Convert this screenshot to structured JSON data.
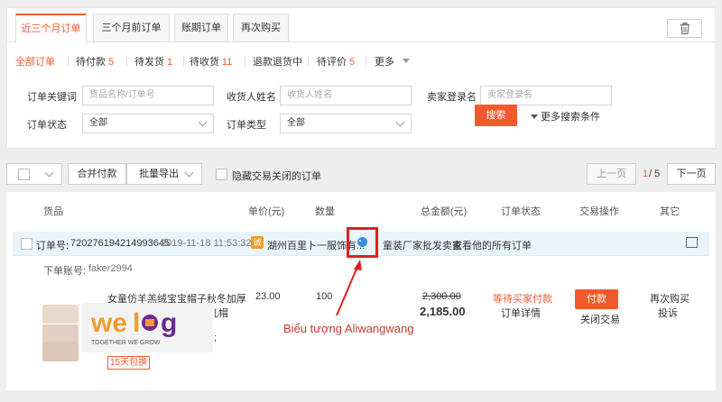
{
  "tabs": [
    {
      "label": "近三个月订单"
    },
    {
      "label": "三个月前订单"
    },
    {
      "label": "账期订单"
    },
    {
      "label": "再次购买"
    }
  ],
  "filters": [
    {
      "label": "全部订单",
      "count": ""
    },
    {
      "label": "待付款",
      "count": "5"
    },
    {
      "label": "待发货",
      "count": "1"
    },
    {
      "label": "待收货",
      "count": "11"
    },
    {
      "label": "退款退货中",
      "count": ""
    },
    {
      "label": "待评价",
      "count": "5"
    },
    {
      "label": "更多",
      "count": ""
    }
  ],
  "search": {
    "order_keyword_label": "订单关键词",
    "order_keyword_placeholder": "货品名称/订单号",
    "receiver_label": "收货人姓名",
    "receiver_placeholder": "收货人姓名",
    "seller_label": "卖家登录名",
    "seller_placeholder": "卖家登录名",
    "status_label": "订单状态",
    "status_value": "全部",
    "type_label": "订单类型",
    "type_value": "全部",
    "search_button": "搜索",
    "more_conditions": "更多搜索条件"
  },
  "toolbar": {
    "merge_pay": "合并付款",
    "batch_export": "批量导出",
    "hide_closed": "隐藏交易关闭的订单",
    "prev_page": "上一页",
    "current_page": "1",
    "total_pages": "/ 5",
    "next_page": "下一页"
  },
  "columns": [
    "货品",
    "单价(元)",
    "数量",
    "总金额(元)",
    "订单状态",
    "交易操作",
    "其它"
  ],
  "order": {
    "number_label": "订单号:",
    "number": "720276194214993645",
    "date": "2019-11-18 11:53:32",
    "shop_icon_text": "诚",
    "shop_name": "湖州百里卜一服饰有...",
    "seller_type": "童装厂家批发卖家",
    "view_all": "查看他的所有订单",
    "account_label": "下单账号:",
    "account": "faker2994",
    "product_line1": "女童仿羊羔绒宝宝帽子秋冬加厚",
    "product_line2": "儿帽",
    "product_line3": ";",
    "tag": "15天包换",
    "unit_price": "23.00",
    "quantity": "100",
    "original_total": "2,300.00",
    "total": "2,185.00",
    "status": "等待买家付款",
    "detail": "订单详情",
    "pay_button": "付款",
    "close_trade": "关闭交易",
    "buy_again": "再次购买",
    "complain": "投诉"
  },
  "annotation": "Biểu tượng Aliwangwang",
  "logo": {
    "brand": "welog",
    "tagline": "TOGETHER WE GROW"
  },
  "colors": {
    "accent": "#f25a2e",
    "annotation": "#c0392b",
    "highlight_box": "#e01f1f",
    "order_bar": "#eaf4fd",
    "aliwangwang": "#3b8fe0"
  },
  "icons": {
    "trash": "trash-icon",
    "aliwangwang": "aliwangwang-icon",
    "message": "message-icon"
  }
}
